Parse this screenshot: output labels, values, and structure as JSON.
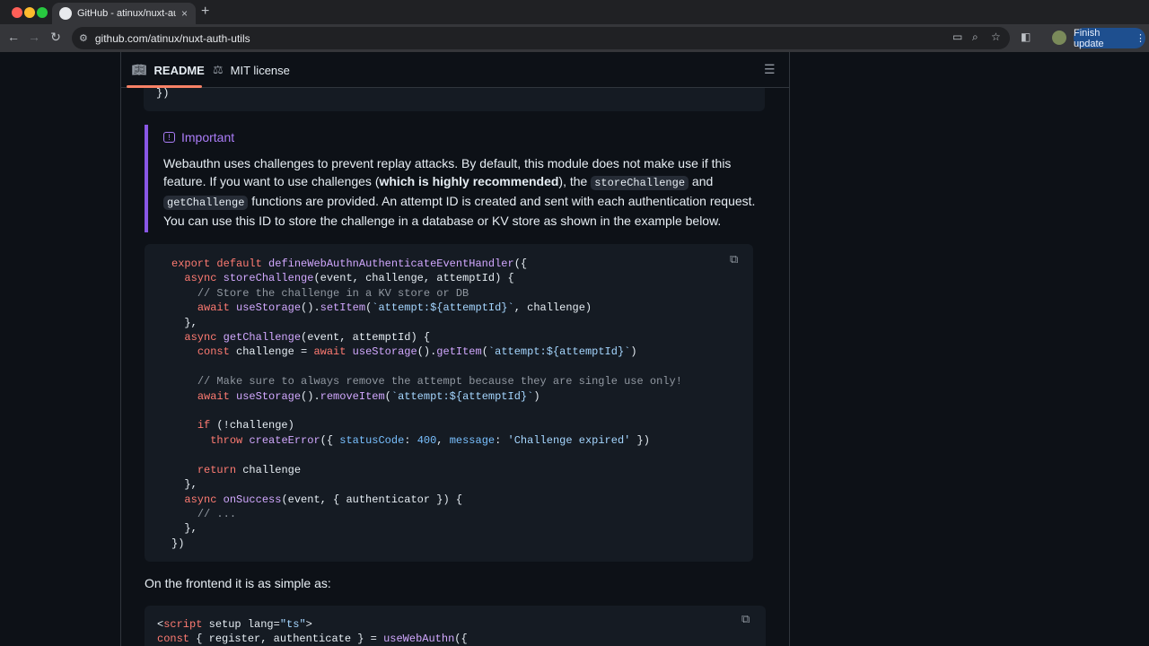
{
  "browser": {
    "tab_title": "GitHub - atinux/nuxt-auth-utils",
    "tab_close": "×",
    "new_tab": "+",
    "url": "github.com/atinux/nuxt-auth-utils",
    "finish_update": "Finish update",
    "colors": {
      "close": "#ff5f57",
      "minimize": "#febc2e",
      "maximize": "#28c840"
    }
  },
  "readme_nav": {
    "readme_tab": "README",
    "license_tab": "MIT license"
  },
  "prev_code_tail": "})",
  "alert": {
    "title": "Important",
    "text_1": "Webauthn uses challenges to prevent replay attacks. By default, this module does not make use if this feature. If you want to use challenges (",
    "bold": "which is highly recommended",
    "text_2": "), the ",
    "code_1": "storeChallenge",
    "text_3": " and ",
    "code_2": "getChallenge",
    "text_4": " functions are provided. An attempt ID is created and sent with each authentication request. You can use this ID to store the challenge in a database or KV store as shown in the example below."
  },
  "code_lines": [
    "export default defineWebAuthnAuthenticateEventHandler({",
    "  async storeChallenge(event, challenge, attemptId) {",
    "    // Store the challenge in a KV store or DB",
    "    await useStorage().setItem(`attempt:${attemptId}`, challenge)",
    "  },",
    "  async getChallenge(event, attemptId) {",
    "    const challenge = await useStorage().getItem(`attempt:${attemptId}`)",
    "",
    "    // Make sure to always remove the attempt because they are single use only!",
    "    await useStorage().removeItem(`attempt:${attemptId}`)",
    "",
    "    if (!challenge)",
    "      throw createError({ statusCode: 400, message: 'Challenge expired' })",
    "",
    "    return challenge",
    "  },",
    "  async onSuccess(event, { authenticator }) {",
    "    // ...",
    "  },",
    "})"
  ],
  "frontend_text": "On the frontend it is as simple as:",
  "frontend_code": [
    "<script setup lang=\"ts\">",
    "const { register, authenticate } = useWebAuthn({"
  ]
}
